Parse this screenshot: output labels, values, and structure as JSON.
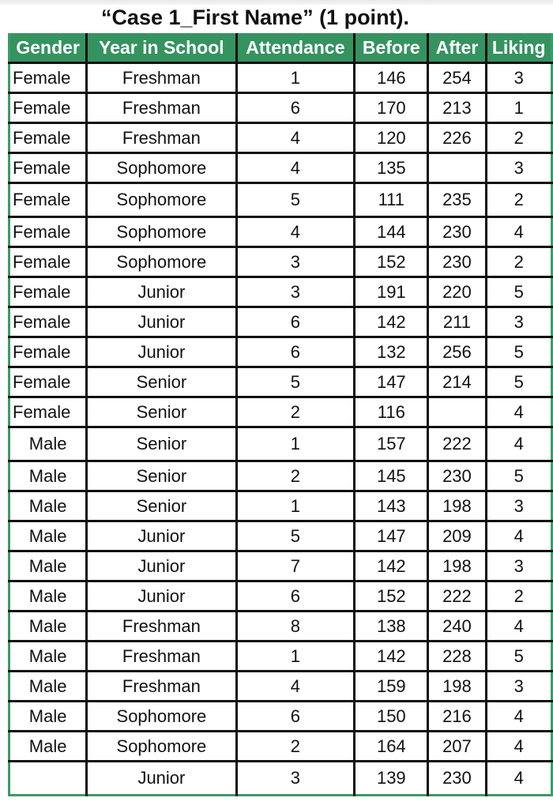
{
  "title": "“Case 1_First Name” (1 point).",
  "colors": {
    "header_bg": "#35935f",
    "border": "#3d9a6b"
  },
  "table": {
    "headers": [
      "Gender",
      "Year in School",
      "Attendance",
      "Before",
      "After",
      "Liking"
    ],
    "rows": [
      [
        "Female",
        "Freshman",
        "1",
        "146",
        "254",
        "3"
      ],
      [
        "Female",
        "Freshman",
        "6",
        "170",
        "213",
        "1"
      ],
      [
        "Female",
        "Freshman",
        "4",
        "120",
        "226",
        "2"
      ],
      [
        "Female",
        "Sophomore",
        "4",
        "135",
        "",
        "3"
      ],
      [
        "Female",
        "Sophomore",
        "5",
        "111",
        "235",
        "2"
      ],
      [
        "Female",
        "Sophomore",
        "4",
        "144",
        "230",
        "4"
      ],
      [
        "Female",
        "Sophomore",
        "3",
        "152",
        "230",
        "2"
      ],
      [
        "Female",
        "Junior",
        "3",
        "191",
        "220",
        "5"
      ],
      [
        "Female",
        "Junior",
        "6",
        "142",
        "211",
        "3"
      ],
      [
        "Female",
        "Junior",
        "6",
        "132",
        "256",
        "5"
      ],
      [
        "Female",
        "Senior",
        "5",
        "147",
        "214",
        "5"
      ],
      [
        "Female",
        "Senior",
        "2",
        "116",
        "",
        "4"
      ],
      [
        "Male",
        "Senior",
        "1",
        "157",
        "222",
        "4"
      ],
      [
        "Male",
        "Senior",
        "2",
        "145",
        "230",
        "5"
      ],
      [
        "Male",
        "Senior",
        "1",
        "143",
        "198",
        "3"
      ],
      [
        "Male",
        "Junior",
        "5",
        "147",
        "209",
        "4"
      ],
      [
        "Male",
        "Junior",
        "7",
        "142",
        "198",
        "3"
      ],
      [
        "Male",
        "Junior",
        "6",
        "152",
        "222",
        "2"
      ],
      [
        "Male",
        "Freshman",
        "8",
        "138",
        "240",
        "4"
      ],
      [
        "Male",
        "Freshman",
        "1",
        "142",
        "228",
        "5"
      ],
      [
        "Male",
        "Freshman",
        "4",
        "159",
        "198",
        "3"
      ],
      [
        "Male",
        "Sophomore",
        "6",
        "150",
        "216",
        "4"
      ],
      [
        "Male",
        "Sophomore",
        "2",
        "164",
        "207",
        "4"
      ],
      [
        "",
        "Junior",
        "3",
        "139",
        "230",
        "4"
      ]
    ]
  }
}
